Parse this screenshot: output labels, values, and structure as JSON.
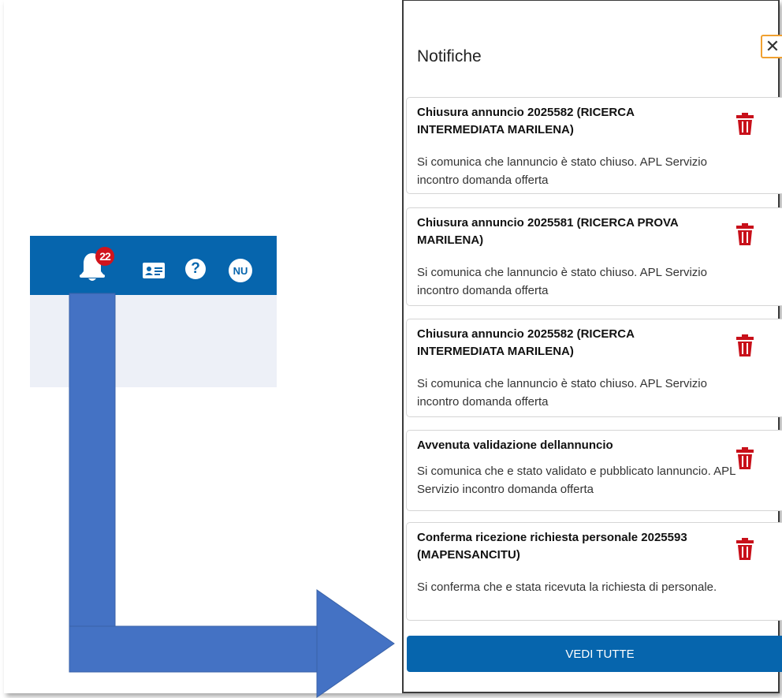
{
  "header": {
    "notification_count": "22",
    "bell_icon": "bell-icon",
    "id_card_icon": "id-card-icon",
    "help_label": "?",
    "avatar_initials": "NU"
  },
  "panel": {
    "title": "Notifiche",
    "close_label": "✕",
    "notifications": [
      {
        "title": "Chiusura annuncio 2025582 (RICERCA INTERMEDIATA MARILENA)",
        "body": "Si comunica che lannuncio è stato chiuso. APL Servizio incontro domanda offerta"
      },
      {
        "title": "Chiusura annuncio 2025581 (RICERCA PROVA MARILENA)",
        "body": "Si comunica che lannuncio è stato chiuso. APL Servizio incontro domanda offerta"
      },
      {
        "title": "Chiusura annuncio 2025582 (RICERCA INTERMEDIATA MARILENA)",
        "body": "Si comunica che lannuncio è stato chiuso. APL Servizio incontro domanda offerta"
      },
      {
        "title": "Avvenuta validazione dellannuncio",
        "body": "Si comunica che e stato validato e pubblicato lannuncio. APL Servizio incontro domanda offerta"
      },
      {
        "title": "Conferma ricezione richiesta personale 2025593 (MAPENSANCITU)",
        "body": "Si conferma che e stata ricevuta la richiesta di personale."
      }
    ],
    "view_all_label": "VEDI TUTTE"
  },
  "colors": {
    "brand_blue": "#0665ad",
    "badge_red": "#d1141d",
    "trash_red": "#c8101a",
    "arrow_blue": "#4472c4"
  }
}
